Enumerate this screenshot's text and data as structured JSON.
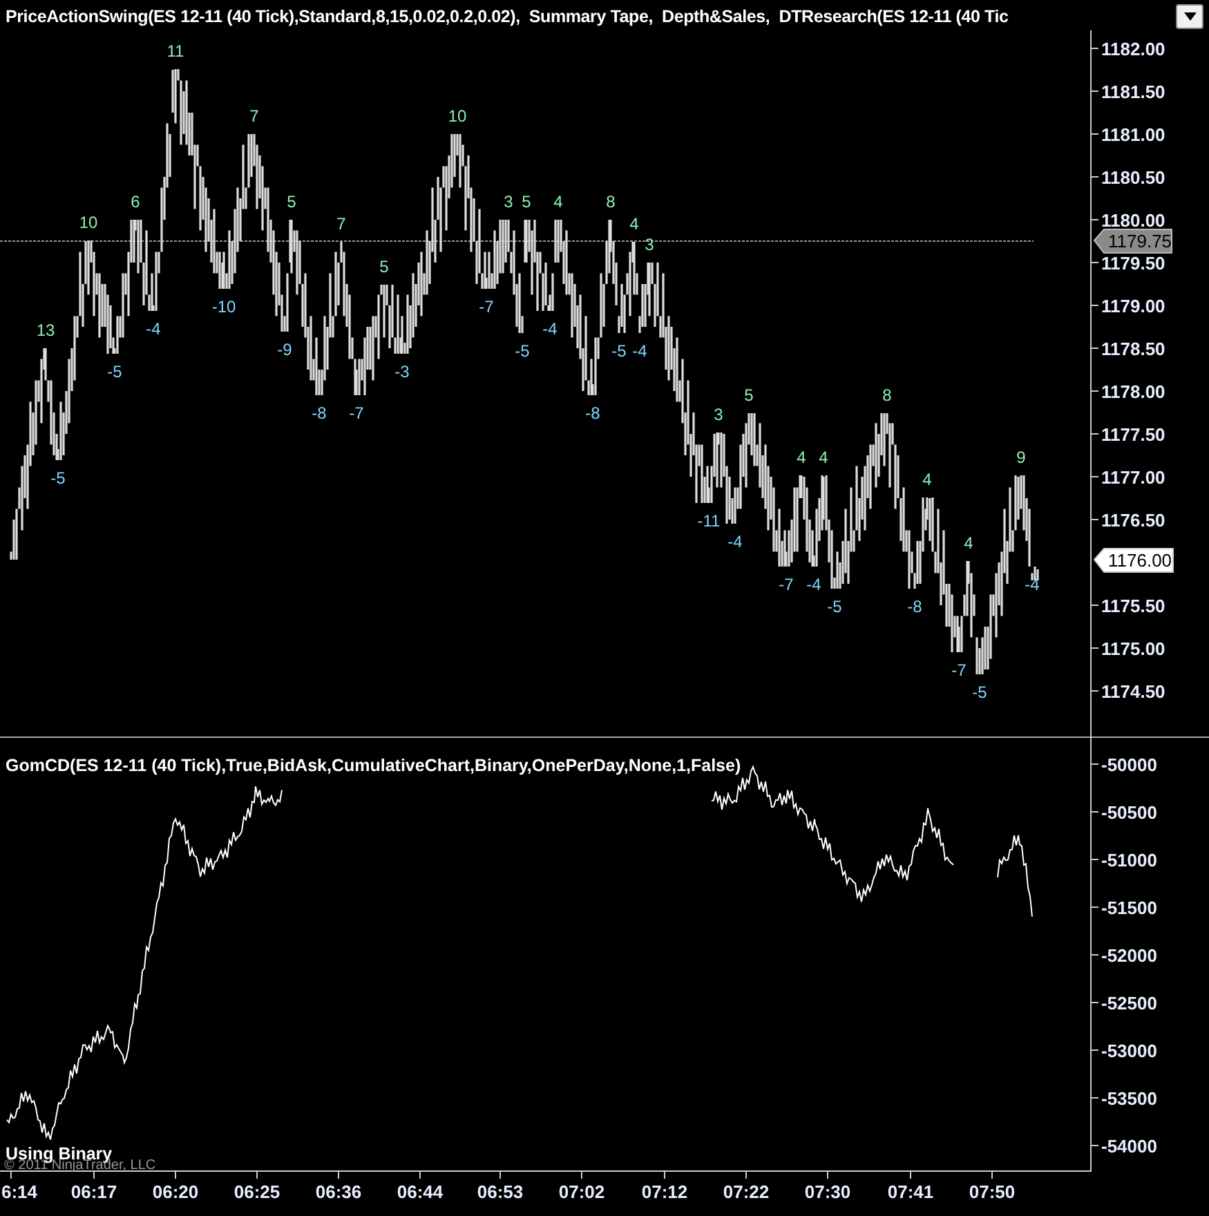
{
  "title_bar": {
    "text": "PriceActionSwing(ES 12-11 (40 Tick),Standard,8,15,0.02,0.2,0.02),  Summary Tape,  Depth&Sales,  DTResearch(ES 12-11 (40 Tic"
  },
  "price_panel": {
    "y_axis": [
      "1182.00",
      "1181.50",
      "1181.00",
      "1180.50",
      "1180.00",
      "1179.50",
      "1179.00",
      "1178.50",
      "1178.00",
      "1177.50",
      "1177.00",
      "1176.50",
      "1175.50",
      "1175.00",
      "1174.50"
    ],
    "reference_tag": "1179.75",
    "last_price_tag": "1176.00",
    "swing_labels": [
      {
        "text": "13",
        "kind": "high"
      },
      {
        "text": "-5",
        "kind": "low"
      },
      {
        "text": "10",
        "kind": "high"
      },
      {
        "text": "-5",
        "kind": "low"
      },
      {
        "text": "6",
        "kind": "high"
      },
      {
        "text": "-4",
        "kind": "low"
      },
      {
        "text": "11",
        "kind": "high"
      },
      {
        "text": "-10",
        "kind": "low"
      },
      {
        "text": "7",
        "kind": "high"
      },
      {
        "text": "-9",
        "kind": "low"
      },
      {
        "text": "5",
        "kind": "high"
      },
      {
        "text": "-8",
        "kind": "low"
      },
      {
        "text": "7",
        "kind": "high"
      },
      {
        "text": "-7",
        "kind": "low"
      },
      {
        "text": "5",
        "kind": "high"
      },
      {
        "text": "-3",
        "kind": "low"
      },
      {
        "text": "10",
        "kind": "high"
      },
      {
        "text": "-7",
        "kind": "low"
      },
      {
        "text": "3",
        "kind": "high"
      },
      {
        "text": "-5",
        "kind": "low"
      },
      {
        "text": "5",
        "kind": "high"
      },
      {
        "text": "-4",
        "kind": "low"
      },
      {
        "text": "4",
        "kind": "high"
      },
      {
        "text": "-8",
        "kind": "low"
      },
      {
        "text": "8",
        "kind": "high"
      },
      {
        "text": "-5",
        "kind": "low"
      },
      {
        "text": "4",
        "kind": "high"
      },
      {
        "text": "-4",
        "kind": "low"
      },
      {
        "text": "3",
        "kind": "high"
      },
      {
        "text": "-11",
        "kind": "low"
      },
      {
        "text": "3",
        "kind": "high"
      },
      {
        "text": "-4",
        "kind": "low"
      },
      {
        "text": "5",
        "kind": "high"
      },
      {
        "text": "-7",
        "kind": "low"
      },
      {
        "text": "4",
        "kind": "high"
      },
      {
        "text": "-4",
        "kind": "low"
      },
      {
        "text": "4",
        "kind": "high"
      },
      {
        "text": "-5",
        "kind": "low"
      },
      {
        "text": "8",
        "kind": "high"
      },
      {
        "text": "-8",
        "kind": "low"
      },
      {
        "text": "4",
        "kind": "high"
      },
      {
        "text": "-7",
        "kind": "low"
      },
      {
        "text": "4",
        "kind": "high"
      },
      {
        "text": "-5",
        "kind": "low"
      },
      {
        "text": "9",
        "kind": "high"
      },
      {
        "text": "-4",
        "kind": "low"
      }
    ]
  },
  "delta_panel": {
    "title": "GomCD(ES  12-11  (40 Tick),True,BidAsk,CumulativeChart,Binary,OnePerDay,None,1,False)",
    "y_axis": [
      "-50000",
      "-50500",
      "-51000",
      "-51500",
      "-52000",
      "-52500",
      "-53000",
      "-53500",
      "-54000"
    ],
    "caption": "Using Binary",
    "copyright": "© 2011 NinjaTrader, LLC"
  },
  "time_axis": [
    "6:14",
    "06:17",
    "06:20",
    "06:25",
    "06:36",
    "06:44",
    "06:53",
    "07:02",
    "07:12",
    "07:22",
    "07:30",
    "07:41",
    "07:50"
  ]
}
